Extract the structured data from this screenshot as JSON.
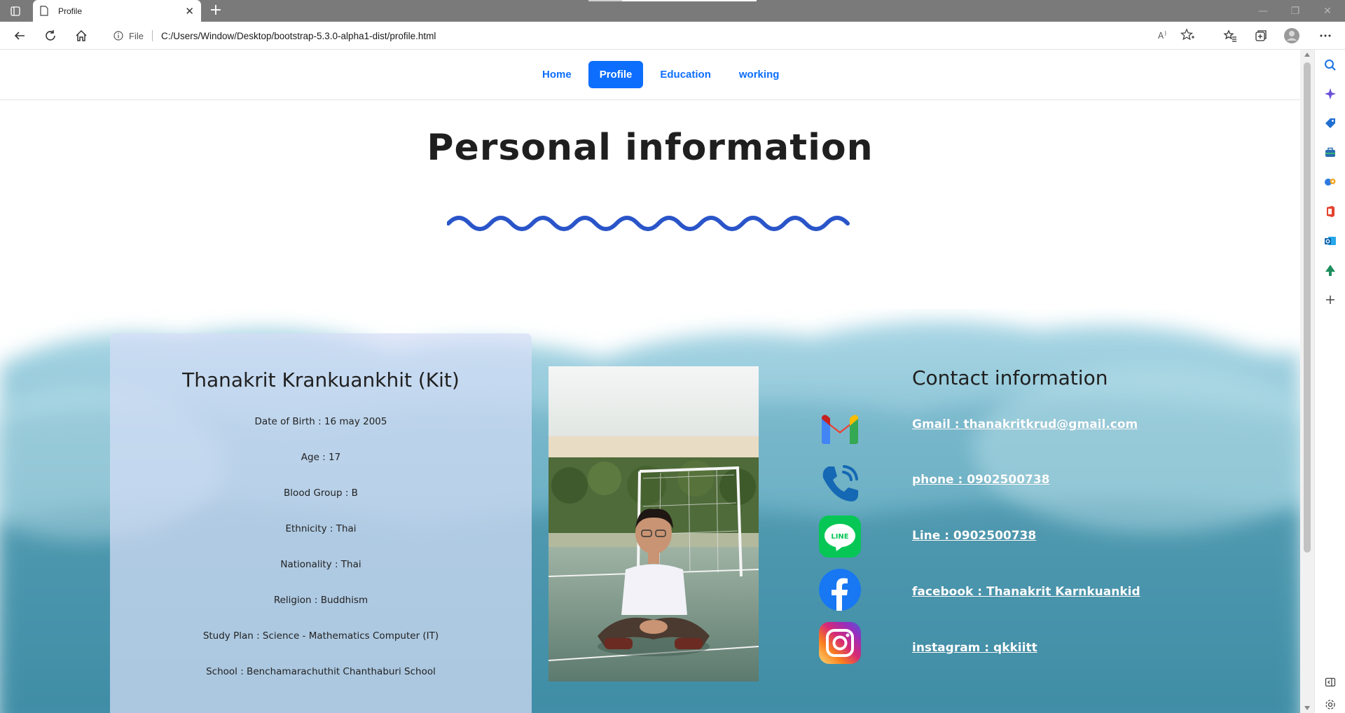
{
  "browser": {
    "tab_title": "Profile",
    "address_prefix": "File",
    "url": "C:/Users/Window/Desktop/bootstrap-5.3.0-alpha1-dist/profile.html"
  },
  "nav": {
    "items": [
      {
        "label": "Home",
        "active": false
      },
      {
        "label": "Profile",
        "active": true
      },
      {
        "label": "Education",
        "active": false
      },
      {
        "label": "working",
        "active": false
      }
    ]
  },
  "page": {
    "title": "Personal information"
  },
  "profile": {
    "name": "Thanakrit Krankuankhit (Kit)",
    "details": [
      "Date of Birth : 16 may 2005",
      "Age : 17",
      "Blood Group : B",
      "Ethnicity : Thai",
      "Nationality : Thai",
      "Religion : Buddhism",
      "Study Plan : Science - Mathematics Computer (IT)",
      "School : Benchamarachuthit Chanthaburi School"
    ]
  },
  "contact": {
    "title": "Contact information",
    "items": [
      {
        "icon": "gmail-icon",
        "label": "Gmail : thanakritkrud@gmail.com"
      },
      {
        "icon": "phone-icon",
        "label": "phone : 0902500738"
      },
      {
        "icon": "line-icon",
        "label": "Line : 0902500738"
      },
      {
        "icon": "facebook-icon",
        "label": "facebook : Thanakrit Karnkuankid"
      },
      {
        "icon": "instagram-icon",
        "label": "instagram : qkkiitt"
      }
    ],
    "line_icon_text": "LINE"
  },
  "colors": {
    "primary": "#0d6efd",
    "wave": "#2a55c9",
    "card_bg": "#d6def6"
  }
}
